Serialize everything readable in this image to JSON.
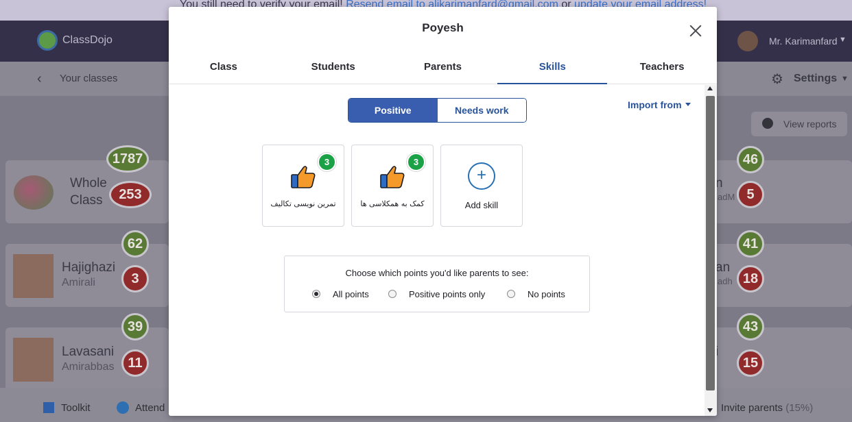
{
  "background": {
    "verify_bar": {
      "prefix": "You still need to verify your email! ",
      "resend_link": "Resend email to alikarimanfard@gmail.com",
      "or_text": " or ",
      "update_link": "update your email address!"
    },
    "brand": "ClassDojo",
    "user_name": "Mr. Karimanfard",
    "back_label": "Your classes",
    "settings_label": "Settings",
    "view_reports_label": "View reports",
    "whole_class": {
      "line1": "Whole",
      "line2": "Class",
      "positive": "1787",
      "negative": "253"
    },
    "students_left": [
      {
        "first": "Hajighazi",
        "last": "Amirali",
        "positive": "62",
        "negative": "3"
      },
      {
        "first": "Lavasani",
        "last": "Amirabbas",
        "positive": "39",
        "negative": "11"
      }
    ],
    "right_cards": [
      {
        "frag1": "n",
        "frag2": "adM",
        "positive": "46",
        "negative": "5"
      },
      {
        "frag1": "an",
        "frag2": "adh",
        "positive": "41",
        "negative": "18"
      },
      {
        "frag1": "i",
        "frag2": "",
        "positive": "43",
        "negative": "15"
      }
    ],
    "bottom": {
      "toolkit_label": "Toolkit",
      "attend_label": "Attend",
      "invite_label": "Invite parents",
      "invite_pct": "(15%)"
    }
  },
  "modal": {
    "title": "Poyesh",
    "tabs": [
      {
        "label": "Class"
      },
      {
        "label": "Students"
      },
      {
        "label": "Parents"
      },
      {
        "label": "Skills"
      },
      {
        "label": "Teachers"
      }
    ],
    "active_tab": "Skills",
    "segment": {
      "positive_label": "Positive",
      "needs_work_label": "Needs work",
      "selected": "Positive"
    },
    "import_from_label": "Import from",
    "skills": [
      {
        "label": "تمرین نویسی تکالیف",
        "count": "3",
        "icon": "thumbs-up-icon"
      },
      {
        "label": "کمک به همکلاسی ها",
        "count": "3",
        "icon": "thumbs-up-icon"
      }
    ],
    "add_skill_label": "Add skill",
    "points_question": "Choose which points you'd like parents to see:",
    "points_options": [
      {
        "label": "All points",
        "checked": true
      },
      {
        "label": "Positive points only",
        "checked": false
      },
      {
        "label": "No points",
        "checked": false
      }
    ]
  },
  "colors": {
    "accent": "#28539a",
    "segment_active": "#3a5eaf",
    "count_badge": "#1ca246",
    "positive_badge": "#587a35",
    "negative_badge": "#912a2a"
  }
}
